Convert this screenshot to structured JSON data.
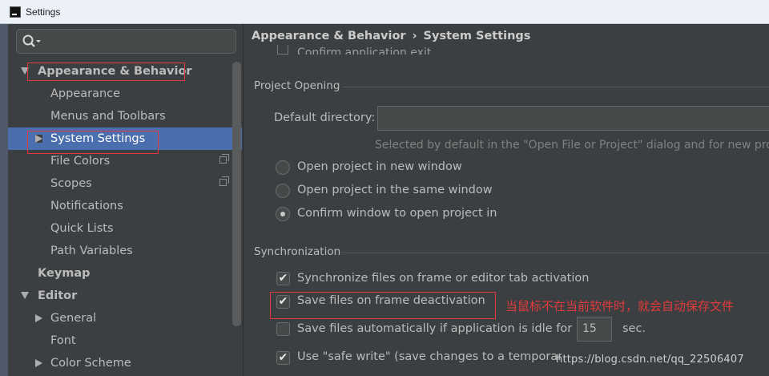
{
  "window": {
    "title": "Settings"
  },
  "search": {
    "placeholder": ""
  },
  "tree": [
    {
      "label": "Appearance & Behavior",
      "bold": true
    },
    {
      "label": "Appearance"
    },
    {
      "label": "Menus and Toolbars"
    },
    {
      "label": "System Settings",
      "selected": true
    },
    {
      "label": "File Colors"
    },
    {
      "label": "Scopes"
    },
    {
      "label": "Notifications"
    },
    {
      "label": "Quick Lists"
    },
    {
      "label": "Path Variables"
    },
    {
      "label": "Keymap",
      "bold": true
    },
    {
      "label": "Editor",
      "bold": true
    },
    {
      "label": "General"
    },
    {
      "label": "Font"
    },
    {
      "label": "Color Scheme"
    }
  ],
  "breadcrumb": {
    "parent": "Appearance & Behavior",
    "separator": "›",
    "current": "System Settings"
  },
  "confirm_exit_partial": "Confirm application exit",
  "project_opening": {
    "title": "Project Opening",
    "default_directory_label": "Default directory:",
    "default_directory_value": "",
    "hint": "Selected by default in the \"Open File or Project\" dialog and for new proje",
    "options": [
      {
        "label": "Open project in new window",
        "selected": false
      },
      {
        "label": "Open project in the same window",
        "selected": false
      },
      {
        "label": "Confirm window to open project in",
        "selected": true
      }
    ]
  },
  "synchronization": {
    "title": "Synchronization",
    "sync_on_activation": {
      "label": "Synchronize files on frame or editor tab activation",
      "checked": true
    },
    "save_on_deactivation": {
      "label": "Save files on frame deactivation",
      "checked": true
    },
    "save_when_idle": {
      "label": "Save files automatically if application is idle for",
      "checked": false,
      "value": "15",
      "unit": "sec."
    },
    "safe_write": {
      "label": "Use \"safe write\" (save changes to a temporary file first)",
      "checked": true
    }
  },
  "annotation": "当鼠标不在当前软件时，就会自动保存文件",
  "watermark": "https://blog.csdn.net/qq_22506407",
  "colors": {
    "selection": "#4b6eaf",
    "background": "#3c3f41",
    "annotation_red": "#e23a3a"
  }
}
